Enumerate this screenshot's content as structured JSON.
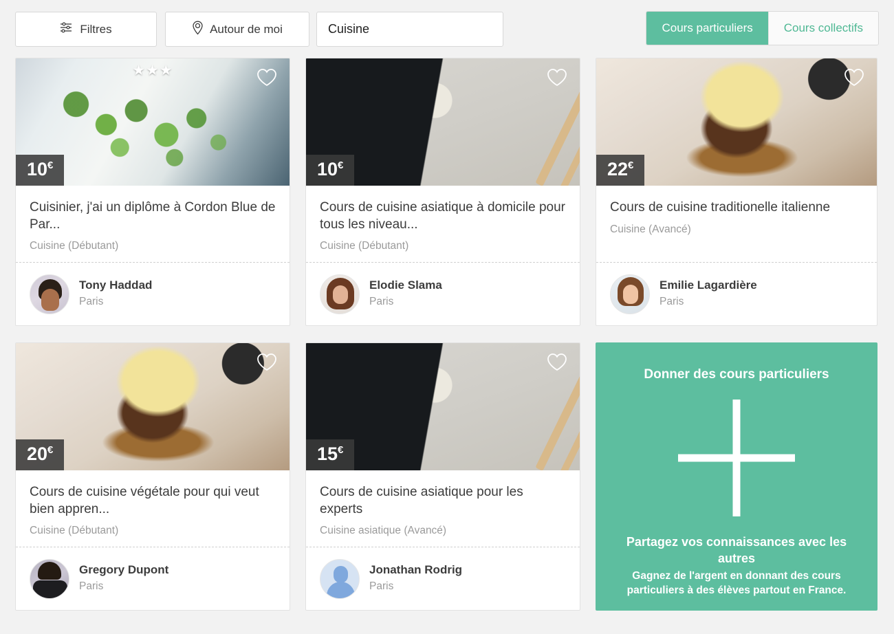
{
  "toolbar": {
    "filters_label": "Filtres",
    "nearby_label": "Autour de moi",
    "search_value": "Cuisine",
    "search_placeholder": "Cuisine",
    "toggle": {
      "active_label": "Cours particuliers",
      "inactive_label": "Cours collectifs"
    }
  },
  "colors": {
    "accent_green": "#5dbe9f",
    "accent_green_text": "#4fb894",
    "page_background": "#f2f2f2",
    "price_badge": "#3a3a3a",
    "title_text": "#3c3c3c",
    "muted_text": "#9a9a9a"
  },
  "cards": [
    {
      "price": "10",
      "currency": "€",
      "stars": "★★★",
      "title": "Cuisinier, j'ai un diplôme à Cordon Blue de Par...",
      "subject": "Cuisine (Débutant)",
      "teacher_name": "Tony Haddad",
      "teacher_city": "Paris"
    },
    {
      "price": "10",
      "currency": "€",
      "stars": "",
      "title": "Cours de cuisine asiatique à domicile pour tous les niveau...",
      "subject": "Cuisine (Débutant)",
      "teacher_name": "Elodie Slama",
      "teacher_city": "Paris"
    },
    {
      "price": "22",
      "currency": "€",
      "stars": "",
      "title": "Cours de cuisine traditionelle italienne",
      "subject": "Cuisine (Avancé)",
      "teacher_name": "Emilie Lagardière",
      "teacher_city": "Paris"
    },
    {
      "price": "20",
      "currency": "€",
      "stars": "",
      "title": "Cours de cuisine végétale pour qui veut bien appren...",
      "subject": "Cuisine (Débutant)",
      "teacher_name": "Gregory Dupont",
      "teacher_city": "Paris"
    },
    {
      "price": "15",
      "currency": "€",
      "stars": "",
      "title": "Cours de cuisine asiatique pour les experts",
      "subject": "Cuisine asiatique (Avancé)",
      "teacher_name": "Jonathan Rodrig",
      "teacher_city": "Paris"
    }
  ],
  "cta": {
    "title": "Donner des cours particuliers",
    "lead": "Partagez vos connaissances avec les autres",
    "description": "Gagnez de l'argent en donnant des cours particuliers à des élèves partout en France."
  }
}
